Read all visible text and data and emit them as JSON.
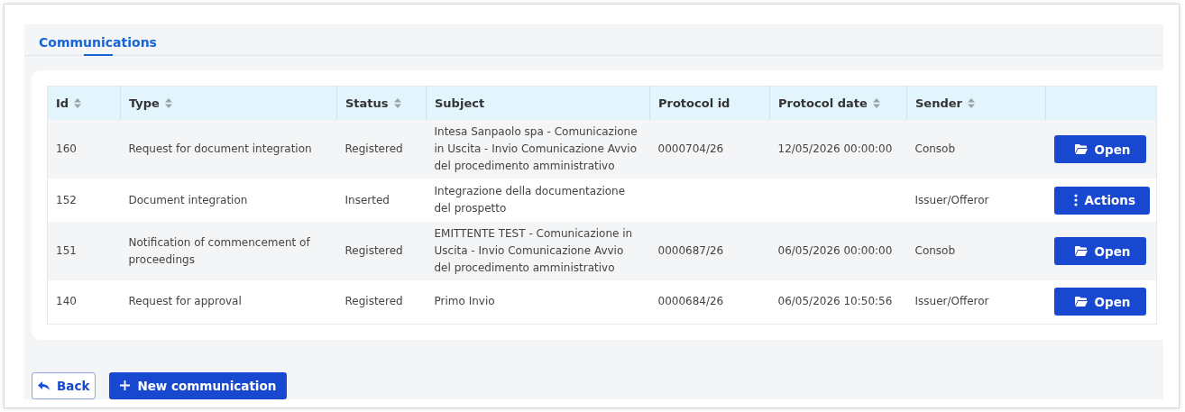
{
  "tabs": [
    {
      "label": "Communications",
      "selected": true
    }
  ],
  "table": {
    "columns": [
      {
        "label": "Id",
        "sortable": true
      },
      {
        "label": "Type",
        "sortable": true
      },
      {
        "label": "Status",
        "sortable": true
      },
      {
        "label": "Subject",
        "sortable": false
      },
      {
        "label": "Protocol id",
        "sortable": false
      },
      {
        "label": "Protocol date",
        "sortable": true
      },
      {
        "label": "Sender",
        "sortable": true
      }
    ],
    "rows": [
      {
        "cells": [
          "160",
          "Request for document integration",
          "Registered",
          "Intesa Sanpaolo spa - Comunicazione in Uscita - Invio Comunicazione Avvio del procedimento amministrativo",
          "0000704/26",
          "12/05/2026 00:00:00",
          "Consob"
        ],
        "action": {
          "kind": "open",
          "label": "Open"
        }
      },
      {
        "cells": [
          "152",
          "Document integration",
          "Inserted",
          "Integrazione della documentazione del prospetto",
          "",
          "",
          "Issuer/Offeror"
        ],
        "action": {
          "kind": "actions",
          "label": "Actions"
        }
      },
      {
        "cells": [
          "151",
          "Notification of commencement of proceedings",
          "Registered",
          "EMITTENTE TEST - Comunicazione in Uscita - Invio Comunicazione Avvio del procedimento amministrativo",
          "0000687/26",
          "06/05/2026 00:00:00",
          "Consob"
        ],
        "action": {
          "kind": "open",
          "label": "Open"
        }
      },
      {
        "cells": [
          "140",
          "Request for approval",
          "Registered",
          "Primo Invio",
          "0000684/26",
          "06/05/2026 10:50:56",
          "Issuer/Offeror"
        ],
        "action": {
          "kind": "open",
          "label": "Open"
        }
      }
    ]
  },
  "buttons": [
    {
      "kind": "back",
      "label": "Back"
    },
    {
      "kind": "new",
      "label": "New communication"
    }
  ]
}
